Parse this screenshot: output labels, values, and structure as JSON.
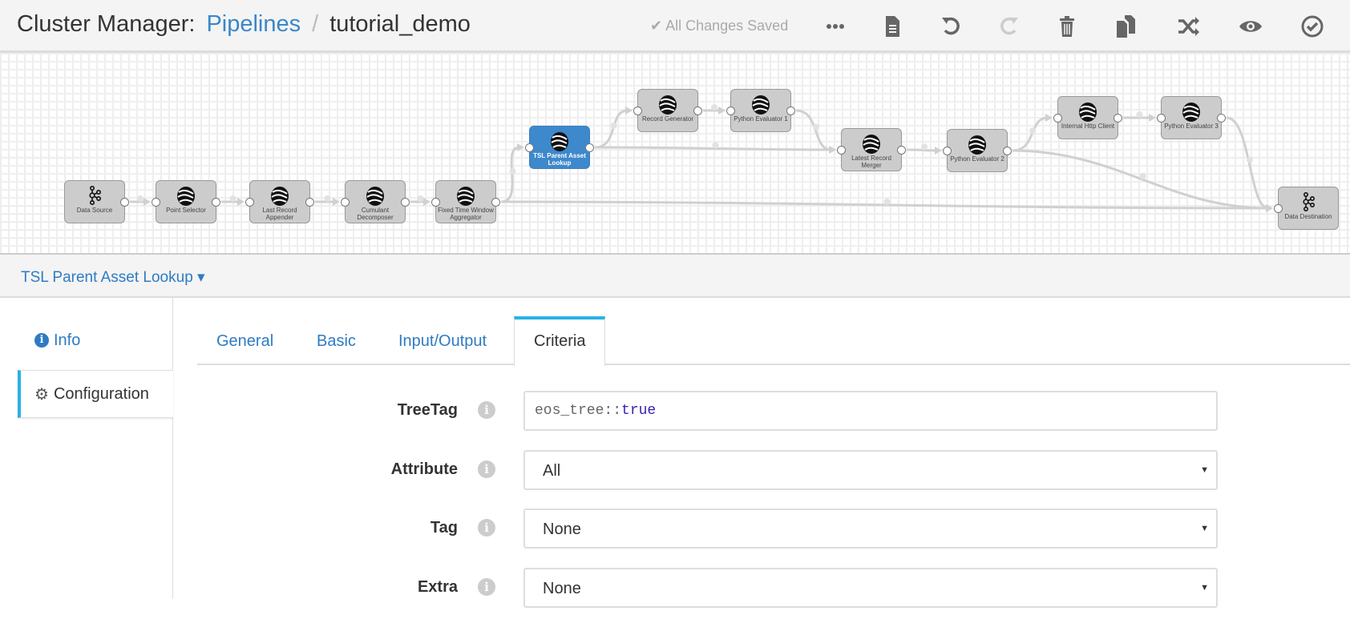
{
  "header": {
    "app": "Cluster Manager:",
    "section": "Pipelines",
    "separator": "/",
    "pipeline": "tutorial_demo",
    "status": "All Changes Saved",
    "toolbar": [
      {
        "icon": "ellipsis-icon",
        "name": "more-button"
      },
      {
        "icon": "file-icon",
        "name": "file-button"
      },
      {
        "icon": "undo-icon",
        "name": "undo-button"
      },
      {
        "icon": "redo-icon",
        "name": "redo-button",
        "disabled": true
      },
      {
        "icon": "trash-icon",
        "name": "delete-button"
      },
      {
        "icon": "copy-icon",
        "name": "copy-button"
      },
      {
        "icon": "shuffle-icon",
        "name": "shuffle-button"
      },
      {
        "icon": "eye-icon",
        "name": "preview-button"
      },
      {
        "icon": "check-circle-icon",
        "name": "validate-button"
      }
    ]
  },
  "pipeline": {
    "nodes": [
      {
        "id": "ds",
        "label": "Data Source",
        "icon": "kafka-icon"
      },
      {
        "id": "ps",
        "label": "Point Selector",
        "icon": "processor-icon"
      },
      {
        "id": "lra",
        "label": "Last Record Appender",
        "icon": "processor-icon"
      },
      {
        "id": "cd",
        "label": "Cumulant Decomposer",
        "icon": "processor-icon"
      },
      {
        "id": "ftw",
        "label": "Fixed Time Window Aggregator",
        "icon": "processor-icon"
      },
      {
        "id": "tsl",
        "label": "TSL Parent Asset Lookup",
        "icon": "processor-icon",
        "selected": true
      },
      {
        "id": "rg",
        "label": "Record Generator",
        "icon": "processor-icon"
      },
      {
        "id": "pe1",
        "label": "Python Evaluator 1",
        "icon": "processor-icon"
      },
      {
        "id": "lrm",
        "label": "Latest Record Merger",
        "icon": "processor-icon"
      },
      {
        "id": "pe2",
        "label": "Python Evaluator 2",
        "icon": "processor-icon"
      },
      {
        "id": "ihc",
        "label": "Internal Http Client",
        "icon": "processor-icon"
      },
      {
        "id": "pe3",
        "label": "Python Evaluator 3",
        "icon": "processor-icon"
      },
      {
        "id": "dd",
        "label": "Data Destination",
        "icon": "kafka-icon"
      }
    ],
    "edges": [
      [
        "ds",
        "ps"
      ],
      [
        "ps",
        "lra"
      ],
      [
        "lra",
        "cd"
      ],
      [
        "cd",
        "ftw"
      ],
      [
        "ftw",
        "tsl"
      ],
      [
        "ftw",
        "dd"
      ],
      [
        "tsl",
        "rg"
      ],
      [
        "tsl",
        "lrm"
      ],
      [
        "rg",
        "pe1"
      ],
      [
        "pe1",
        "lrm"
      ],
      [
        "lrm",
        "pe2"
      ],
      [
        "pe2",
        "ihc"
      ],
      [
        "pe2",
        "dd"
      ],
      [
        "ihc",
        "pe3"
      ],
      [
        "pe3",
        "dd"
      ]
    ]
  },
  "panel": {
    "title": "TSL Parent Asset Lookup",
    "side": {
      "info": "Info",
      "configuration": "Configuration"
    },
    "tabs": [
      "General",
      "Basic",
      "Input/Output",
      "Criteria"
    ],
    "active_tab": "Criteria",
    "form": {
      "treetag": {
        "label": "TreeTag",
        "value_prefix": "eos_tree::",
        "value_keyword": "true"
      },
      "attribute": {
        "label": "Attribute",
        "value": "All"
      },
      "tag": {
        "label": "Tag",
        "value": "None"
      },
      "extra": {
        "label": "Extra",
        "value": "None"
      }
    }
  },
  "colors": {
    "accent": "#2e7bc4",
    "selected_node": "#3e88cc",
    "tab_indicator": "#2bb0e6"
  }
}
